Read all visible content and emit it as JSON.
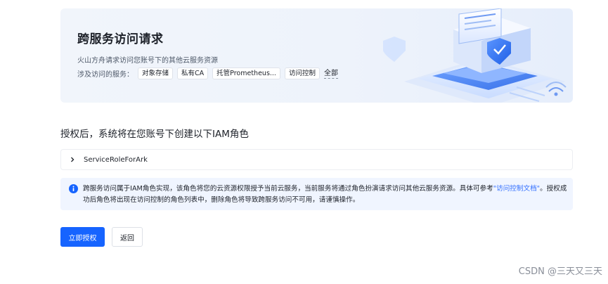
{
  "banner": {
    "title": "跨服务访问请求",
    "description": "火山方舟请求访问您账号下的其他云服务资源",
    "services_label": "涉及访问的服务：",
    "services": [
      "对象存储",
      "私有CA",
      "托管Prometheus...",
      "访问控制"
    ],
    "all_link": "全部"
  },
  "section": {
    "title": "授权后，系统将在您账号下创建以下IAM角色"
  },
  "role": {
    "name": "ServiceRoleForArk"
  },
  "notice": {
    "text_before": "跨服务访问属于IAM角色实现，该角色将您的云资源权限授予当前云服务，当前服务将通过角色扮演请求访问其他云服务资源。具体可参考",
    "link": "\"访问控制文档\"",
    "text_after": "。授权成功后角色将出现在访问控制的角色列表中，删除角色将导致跨服务访问不可用，请谨慎操作。"
  },
  "actions": {
    "authorize": "立即授权",
    "back": "返回"
  },
  "watermark": "CSDN @三天又三天",
  "colors": {
    "primary": "#1664ff",
    "notice_bg": "#f0f5ff",
    "link": "#3370ff"
  }
}
